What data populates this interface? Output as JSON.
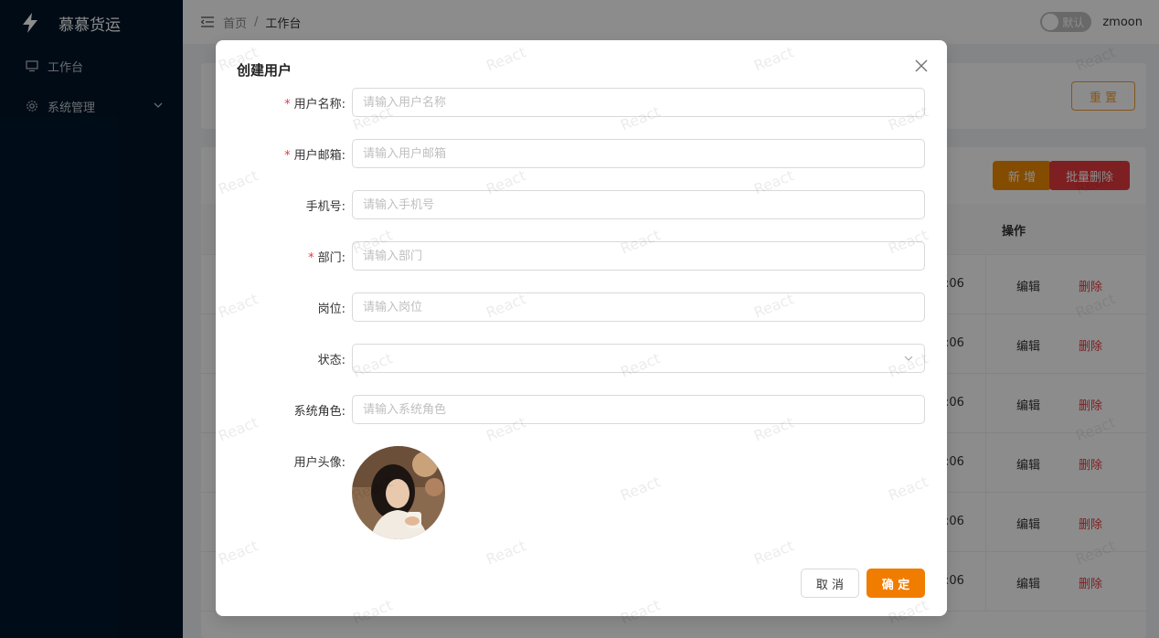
{
  "app": {
    "title": "慕慕货运"
  },
  "sidebar": {
    "items": [
      {
        "label": "工作台",
        "icon": "desktop-icon"
      },
      {
        "label": "系统管理",
        "icon": "gear-icon"
      }
    ]
  },
  "header": {
    "breadcrumb": [
      "首页",
      "工作台"
    ],
    "breadcrumb_sep": "/",
    "theme_switch_label": "默认",
    "username": "zmoon"
  },
  "background": {
    "reset_label": "重 置",
    "add_label": "新 增",
    "batch_delete_label": "批量删除",
    "op_header": "操作",
    "rows": [
      {
        "time": ":06",
        "edit": "编辑",
        "delete": "删除"
      },
      {
        "time": ":06",
        "edit": "编辑",
        "delete": "删除"
      },
      {
        "time": ":06",
        "edit": "编辑",
        "delete": "删除"
      },
      {
        "time": ":06",
        "edit": "编辑",
        "delete": "删除"
      },
      {
        "time": ":06",
        "edit": "编辑",
        "delete": "删除"
      },
      {
        "time": ":06",
        "edit": "编辑",
        "delete": "删除"
      }
    ]
  },
  "modal": {
    "title": "创建用户",
    "fields": [
      {
        "label": "用户名称:",
        "required": true,
        "placeholder": "请输入用户名称",
        "value": ""
      },
      {
        "label": "用户邮箱:",
        "required": true,
        "placeholder": "请输入用户邮箱",
        "value": ""
      },
      {
        "label": "手机号:",
        "required": false,
        "placeholder": "请输入手机号",
        "value": ""
      },
      {
        "label": "部门:",
        "required": true,
        "placeholder": "请输入部门",
        "value": ""
      },
      {
        "label": "岗位:",
        "required": false,
        "placeholder": "请输入岗位",
        "value": ""
      },
      {
        "label": "状态:",
        "required": false,
        "placeholder": "",
        "value": ""
      },
      {
        "label": "系统角色:",
        "required": false,
        "placeholder": "请输入系统角色",
        "value": ""
      }
    ],
    "avatar_label": "用户头像:",
    "cancel_label": "取 消",
    "ok_label": "确 定",
    "required_mark": "*"
  },
  "watermark": {
    "text": "React"
  },
  "colors": {
    "primary": "#f07c00",
    "danger": "#e6393d",
    "sidebar_bg": "#001529"
  }
}
